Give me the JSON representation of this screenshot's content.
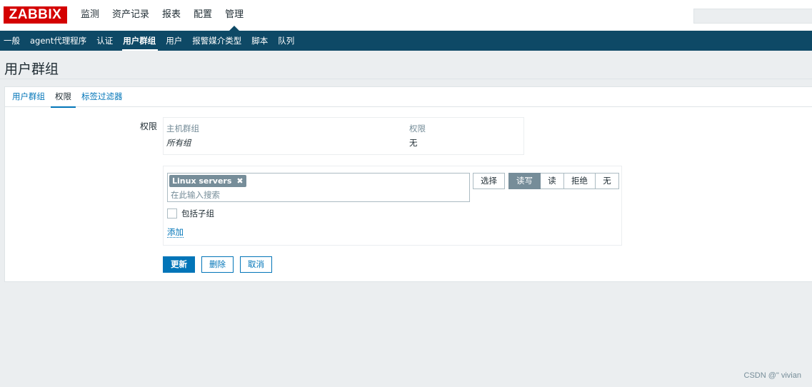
{
  "header": {
    "logo_text": "ZABBIX",
    "menu": [
      {
        "label": "监测"
      },
      {
        "label": "资产记录"
      },
      {
        "label": "报表"
      },
      {
        "label": "配置"
      },
      {
        "label": "管理",
        "active": true
      }
    ],
    "search": {
      "placeholder": "",
      "value": ""
    }
  },
  "subnav": {
    "items": [
      {
        "label": "一般"
      },
      {
        "label": "agent代理程序"
      },
      {
        "label": "认证"
      },
      {
        "label": "用户群组",
        "active": true
      },
      {
        "label": "用户"
      },
      {
        "label": "报警媒介类型"
      },
      {
        "label": "脚本"
      },
      {
        "label": "队列"
      }
    ]
  },
  "page": {
    "title": "用户群组"
  },
  "tabs": [
    {
      "label": "用户群组"
    },
    {
      "label": "权限",
      "active": true
    },
    {
      "label": "标签过滤器"
    }
  ],
  "form": {
    "permissions_label": "权限",
    "table": {
      "columns": [
        "主机群组",
        "权限"
      ],
      "rows": [
        {
          "group": "所有组",
          "permission": "无"
        }
      ]
    },
    "multiselect": {
      "chips": [
        {
          "label": "Linux servers",
          "remove_icon": "close-icon"
        }
      ],
      "placeholder": "在此输入搜索"
    },
    "select_button": "选择",
    "permission_options": [
      {
        "label": "读写",
        "selected": true
      },
      {
        "label": "读"
      },
      {
        "label": "拒绝"
      },
      {
        "label": "无"
      }
    ],
    "include_subgroups": {
      "label": "包括子组",
      "checked": false
    },
    "add_link": "添加",
    "buttons": {
      "update": "更新",
      "delete": "删除",
      "cancel": "取消"
    }
  },
  "watermark": "CSDN @\" vivian",
  "colors": {
    "brand_red": "#d40000",
    "nav_blue": "#0e4966",
    "link_blue": "#0275b8",
    "selected_gray": "#768d99"
  }
}
